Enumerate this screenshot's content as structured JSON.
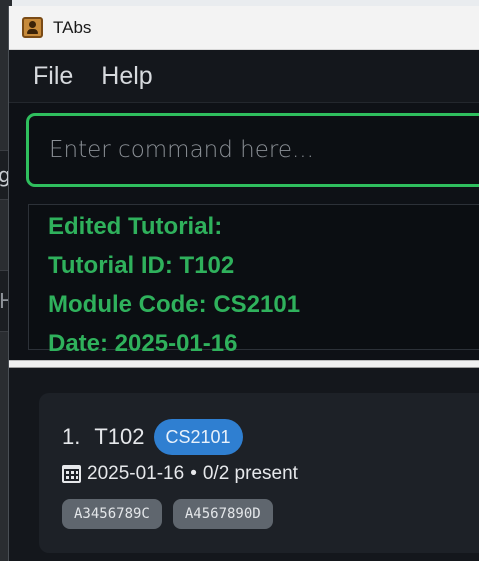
{
  "window": {
    "title": "TAbs",
    "app_icon": "contact-card-icon"
  },
  "menubar": {
    "items": [
      {
        "label": "File"
      },
      {
        "label": "Help"
      }
    ]
  },
  "command": {
    "placeholder": "Enter command here...",
    "value": ""
  },
  "result": {
    "lines": [
      "Edited Tutorial:",
      "Tutorial ID: T102",
      "Module Code: CS2101",
      "Date: 2025-01-16"
    ],
    "color": "#2fb15c"
  },
  "tutorials": [
    {
      "index": "1.",
      "id": "T102",
      "module": "CS2101",
      "date": "2025-01-16",
      "attendance": "0/2 present",
      "students": [
        "A3456789C",
        "A4567890D"
      ]
    }
  ],
  "colors": {
    "accent_green": "#2fbf5e",
    "module_badge": "#2f7fd1",
    "tag": "#5f666e"
  }
}
